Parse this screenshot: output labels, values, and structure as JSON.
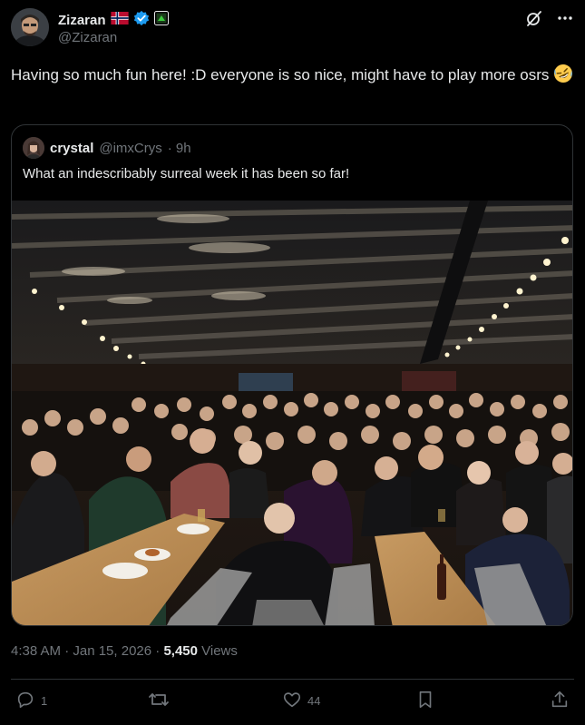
{
  "author": {
    "display_name": "Zizaran",
    "handle": "@Zizaran",
    "flag": "norway-flag",
    "verified_icon": "verified-badge-icon",
    "affiliate_icon": "affiliate-badge-icon"
  },
  "tweet": {
    "text": "Having so much fun here! :D everyone is so nice, might have to play more osrs",
    "emoji": "🤣"
  },
  "quote": {
    "display_name": "crystal",
    "handle": "@imxCrys",
    "time": "· 9h",
    "text": "What an indescribably surreal week it has been so far!"
  },
  "meta": {
    "timestamp": "4:38 AM · Jan 15, 2026 · ",
    "views_count": "5,450",
    "views_label": " Views"
  },
  "actions": {
    "reply_count": "1",
    "retweet_count": "",
    "like_count": "44"
  },
  "colors": {
    "background": "#000000",
    "text": "#e7e9ea",
    "muted": "#71767b",
    "border": "#2f3336",
    "verified": "#1d9bf0"
  }
}
